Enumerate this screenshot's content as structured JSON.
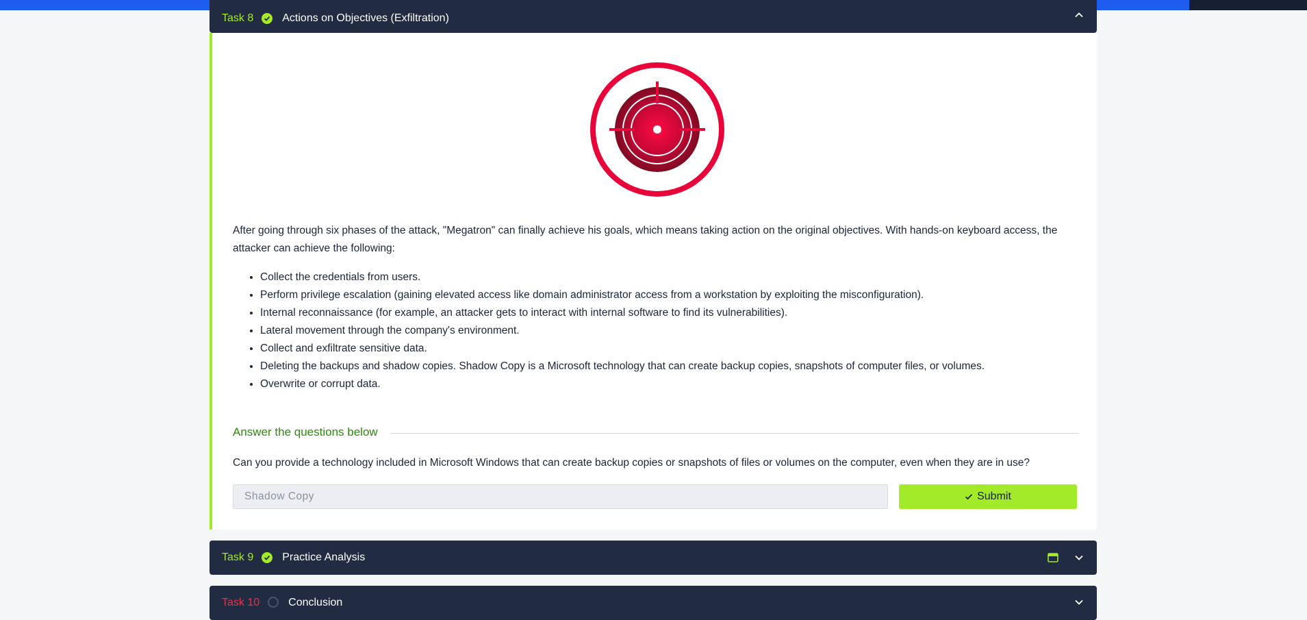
{
  "progress": {
    "label": "Room progress ( 91% )",
    "value": 0.91
  },
  "colors": {
    "accent_green": "#a3ea2a",
    "accent_blue": "#1e5cf0",
    "header_bg": "#212c42",
    "target_red": "#e8053a",
    "task10_red": "#e8324b"
  },
  "task8": {
    "number": "Task 8",
    "title": "Actions on Objectives (Exfiltration)",
    "status_icon": "check-circle-icon",
    "collapse_icon": "chevron-up-icon",
    "image_icon": "target-crosshair-icon",
    "intro": "After going through six phases of the attack, \"Megatron\" can finally achieve his goals, which means taking action on the original objectives. With hands-on keyboard access, the attacker can achieve the following:",
    "bullets": [
      "Collect the credentials from users.",
      "Perform privilege escalation (gaining elevated access like domain administrator access from a workstation by exploiting the misconfiguration).",
      "Internal reconnaissance (for example, an attacker gets to interact with internal software to find its vulnerabilities).",
      "Lateral movement through the company's environment.",
      "Collect and exfiltrate sensitive data.",
      "Deleting the backups and shadow copies. Shadow Copy is a Microsoft technology that can create backup copies, snapshots of computer files, or volumes.",
      "Overwrite or corrupt data."
    ],
    "answer_heading": "Answer the questions below",
    "question": "Can you provide a technology included in Microsoft Windows that can create backup copies or snapshots of files or volumes on the computer, even when they are in use?",
    "answer_value": "Shadow Copy",
    "submit_label": "Submit",
    "submit_icon": "check-icon"
  },
  "task9": {
    "number": "Task 9",
    "title": "Practice Analysis",
    "status_icon": "check-circle-icon",
    "extra_icon": "browser-window-icon",
    "collapse_icon": "chevron-down-icon"
  },
  "task10": {
    "number": "Task 10",
    "title": "Conclusion",
    "status_icon": "circle-outline-icon",
    "collapse_icon": "chevron-down-icon"
  }
}
